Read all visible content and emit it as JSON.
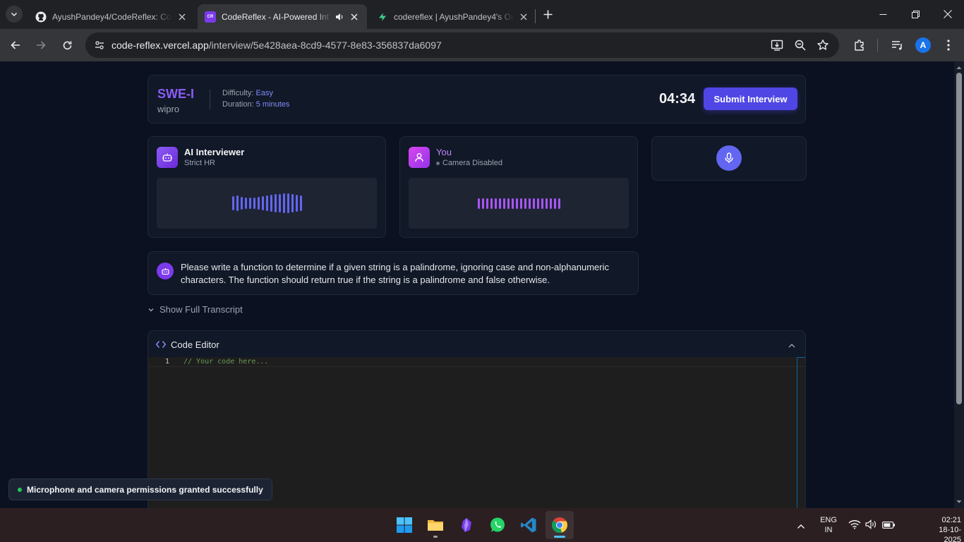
{
  "browser": {
    "tabs": [
      {
        "title": "AyushPandey4/CodeReflex: Code",
        "icon": "github-icon"
      },
      {
        "title": "CodeReflex - AI-Powered Int",
        "icon": "codereflex-icon",
        "favicon_text": "CR",
        "audio": "speaker-icon"
      },
      {
        "title": "codereflex | AyushPandey4's Org",
        "icon": "supabase-icon"
      }
    ],
    "url_host": "code-reflex.vercel.app",
    "url_path": "/interview/5e428aea-8cd9-4577-8e83-356837da6097",
    "profile_initial": "A"
  },
  "interview": {
    "role": "SWE-I",
    "company": "wipro",
    "difficulty_label": "Difficulty:",
    "difficulty": "Easy",
    "duration_label": "Duration:",
    "duration": "5 minutes",
    "timer": "04:34",
    "submit_label": "Submit Interview"
  },
  "participants": {
    "ai": {
      "name": "AI Interviewer",
      "subtitle": "Strict HR"
    },
    "user": {
      "name": "You",
      "status": "Camera Disabled"
    }
  },
  "question": "Please write a function to determine if a given string is a palindrome, ignoring case and non-alphanumeric characters. The function should return true if the string is a palindrome and false otherwise.",
  "transcript_toggle": "Show Full Transcript",
  "editor": {
    "title": "Code Editor",
    "line_number": "1",
    "code": "// Your code here..."
  },
  "toast": "Microphone and camera permissions granted successfully",
  "taskbar": {
    "language": "ENG",
    "region": "IN",
    "time": "02:21",
    "date": "18-10-2025"
  },
  "colors": {
    "accent": "#4f46e5",
    "role": "#8b5cf6",
    "page_bg": "#0b1120",
    "card_bg": "#111827",
    "success": "#22c55e"
  }
}
